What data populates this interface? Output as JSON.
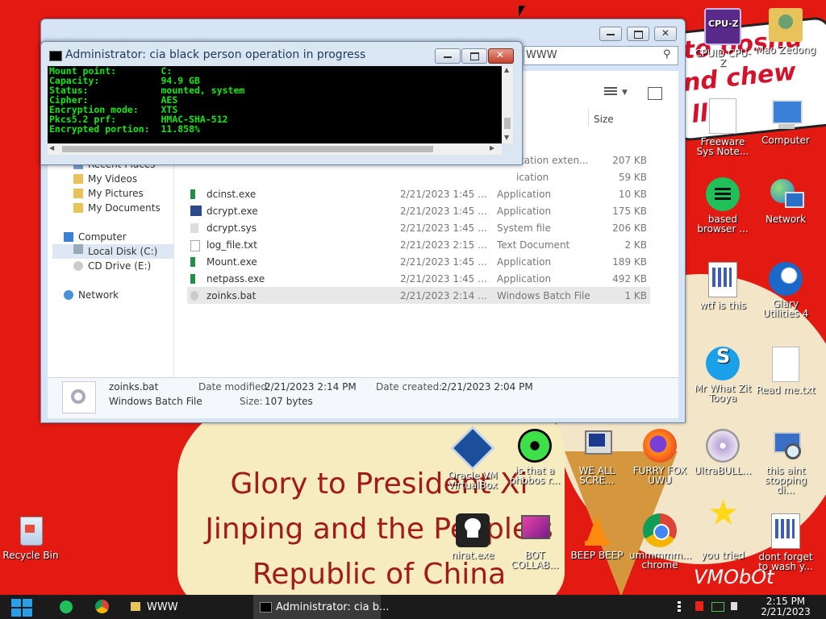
{
  "desktop": {
    "icons": [
      {
        "id": "cpuz",
        "label": "CPUID CPU-Z"
      },
      {
        "id": "mao",
        "label": "Mao Zedong"
      },
      {
        "id": "freeware",
        "label": "Freeware Sys Note..."
      },
      {
        "id": "computer",
        "label": "Computer"
      },
      {
        "id": "based",
        "label": "based browser ..."
      },
      {
        "id": "network",
        "label": "Network"
      },
      {
        "id": "wtf",
        "label": "wtf is this"
      },
      {
        "id": "glary",
        "label": "Glary Utilities 4"
      },
      {
        "id": "skype",
        "label": "Mr What Zit Tooya"
      },
      {
        "id": "readme",
        "label": "Read me.txt"
      },
      {
        "id": "oracle",
        "label": "Oracle VM VirtualBox"
      },
      {
        "id": "phobos",
        "label": "is that a phobos r..."
      },
      {
        "id": "weall",
        "label": "WE ALL SCRE..."
      },
      {
        "id": "furry",
        "label": "FURRY FOX UWU"
      },
      {
        "id": "ultrabull",
        "label": "UltraBULL..."
      },
      {
        "id": "aint",
        "label": "this aint stopping di..."
      },
      {
        "id": "recycle",
        "label": "Recycle Bin"
      },
      {
        "id": "nirat",
        "label": "nirat.exe"
      },
      {
        "id": "bot",
        "label": "BOT COLLAB..."
      },
      {
        "id": "beep",
        "label": "BEEP BEEP"
      },
      {
        "id": "chrome",
        "label": "ummmmm... chrome"
      },
      {
        "id": "youtried",
        "label": "you tried"
      },
      {
        "id": "dontforget",
        "label": "dont forget to wash y..."
      }
    ]
  },
  "wallpaper": {
    "line1": "Glory to President Xi",
    "line2": "Jinping and the People's",
    "line3": "Republic of China",
    "paper1": "to boshu",
    "paper2": "nd chew",
    "paper3": "llin",
    "signature": "VMObOt"
  },
  "explorer": {
    "address": "WWW",
    "column_size": "Size",
    "nav": [
      {
        "label": "Recent Places"
      },
      {
        "label": "My Videos"
      },
      {
        "label": "My Pictures"
      },
      {
        "label": "My Documents"
      },
      {
        "label": "Computer"
      },
      {
        "label": "Local Disk (C:)"
      },
      {
        "label": "CD Drive (E:)"
      },
      {
        "label": "Network"
      }
    ],
    "files": [
      {
        "name": "",
        "date": "",
        "type": "ication exten...",
        "size": "207 KB"
      },
      {
        "name": "",
        "date": "",
        "type": "ication",
        "size": "59 KB"
      },
      {
        "name": "dcinst.exe",
        "date": "2/21/2023 1:45 ...",
        "type": "Application",
        "size": "10 KB"
      },
      {
        "name": "dcrypt.exe",
        "date": "2/21/2023 1:45 ...",
        "type": "Application",
        "size": "175 KB"
      },
      {
        "name": "dcrypt.sys",
        "date": "2/21/2023 1:45 ...",
        "type": "System file",
        "size": "206 KB"
      },
      {
        "name": "log_file.txt",
        "date": "2/21/2023 2:15 ...",
        "type": "Text Document",
        "size": "2 KB"
      },
      {
        "name": "Mount.exe",
        "date": "2/21/2023 1:45 ...",
        "type": "Application",
        "size": "189 KB"
      },
      {
        "name": "netpass.exe",
        "date": "2/21/2023 1:45 ...",
        "type": "Application",
        "size": "492 KB"
      },
      {
        "name": "zoinks.bat",
        "date": "2/21/2023 2:14 ...",
        "type": "Windows Batch File",
        "size": "1 KB"
      }
    ],
    "details": {
      "name": "zoinks.bat",
      "type": "Windows Batch File",
      "modified_label": "Date modified:",
      "modified": "2/21/2023 2:14 PM",
      "created_label": "Date created:",
      "created": "2/21/2023 2:04 PM",
      "size_label": "Size:",
      "size": "107 bytes"
    }
  },
  "console": {
    "title": "Administrator:  cia black person operation in progress",
    "lines": [
      "Mount point:        C:",
      "Capacity:           94.9 GB",
      "Status:             mounted, system",
      "Cipher:             AES",
      "Encryption mode:    XTS",
      "Pkcs5.2 prf:        HMAC-SHA-512",
      "Encrypted portion:  11.858%"
    ]
  },
  "taskbar": {
    "explorer_label": "WWW",
    "console_label": "Administrator:  cia b...",
    "time": "2:15 PM",
    "date": "2/21/2023"
  }
}
